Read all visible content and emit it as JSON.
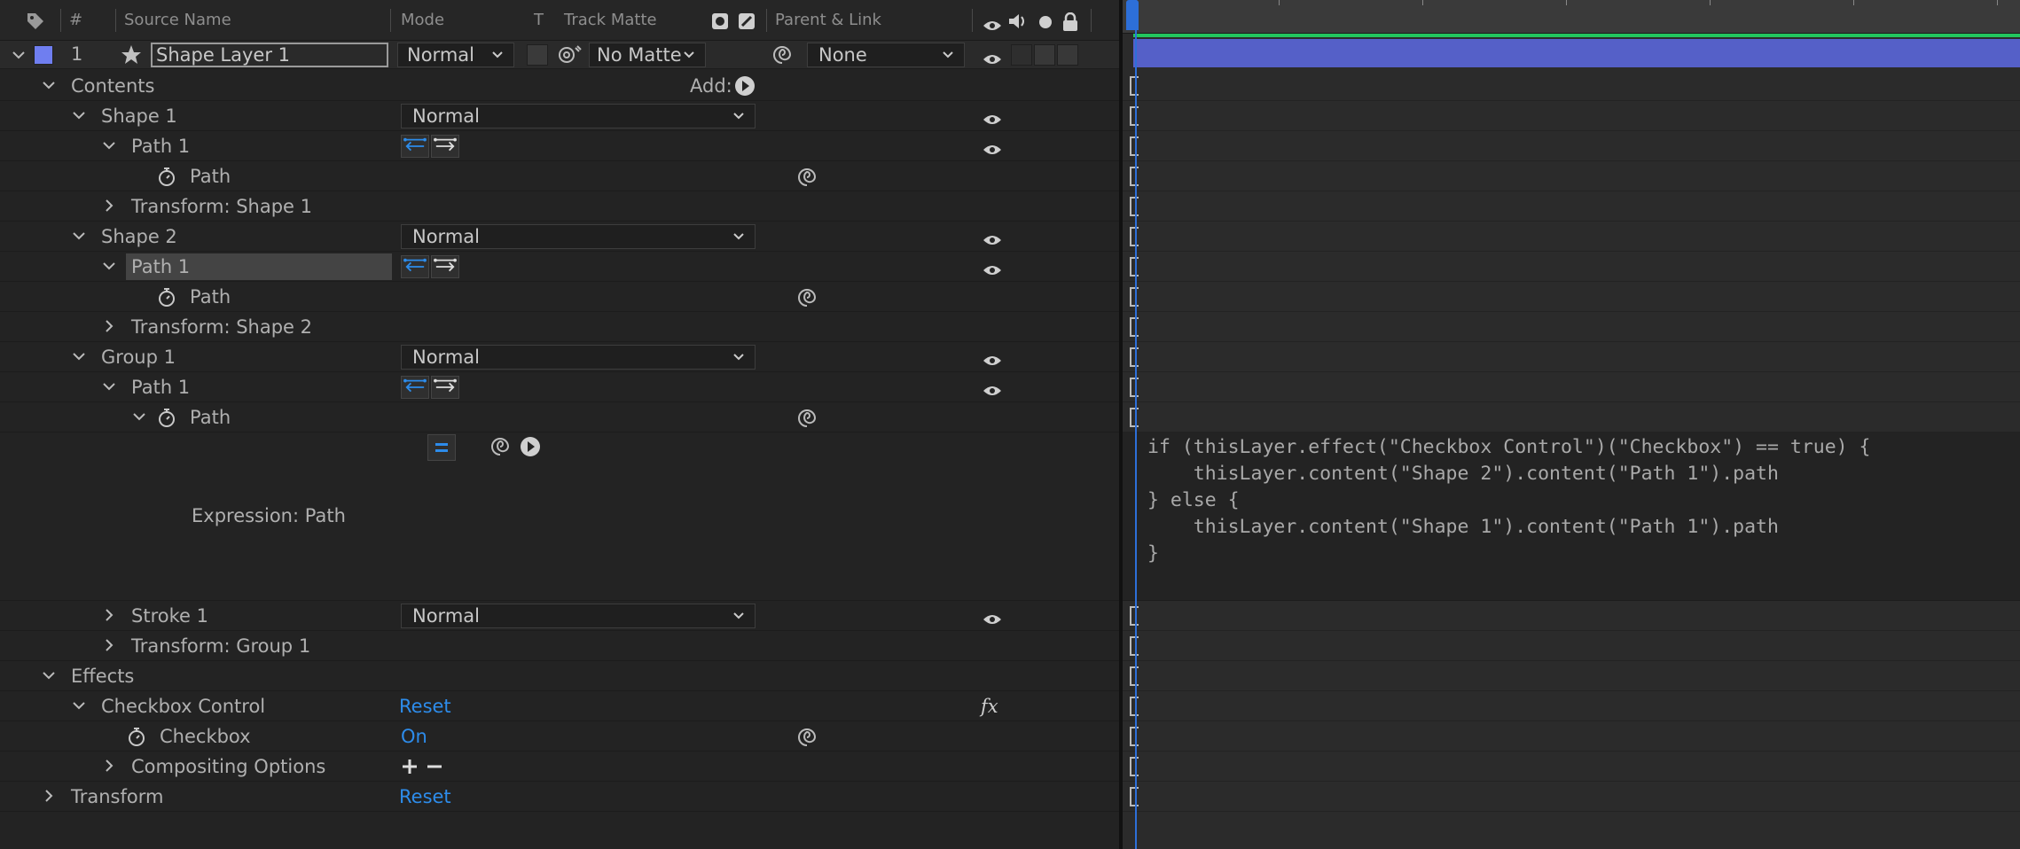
{
  "header": {
    "num": "#",
    "source_name": "Source Name",
    "mode": "Mode",
    "t": "T",
    "track_matte": "Track Matte",
    "parent_link": "Parent & Link"
  },
  "layer": {
    "number": "1",
    "name": "Shape Layer 1",
    "mode": "Normal",
    "track_matte": "No Matte",
    "parent": "None",
    "label_color": "#6f7ef0"
  },
  "rows": {
    "contents": "Contents",
    "add": "Add:",
    "shape1": "Shape 1",
    "shape1_mode": "Normal",
    "path1_a": "Path 1",
    "path_a": "Path",
    "transform_shape1": "Transform: Shape 1",
    "shape2": "Shape 2",
    "shape2_mode": "Normal",
    "path1_b": "Path 1",
    "path_b": "Path",
    "transform_shape2": "Transform: Shape 2",
    "group1": "Group 1",
    "group1_mode": "Normal",
    "path1_c": "Path 1",
    "path_c": "Path",
    "expression_label": "Expression: Path",
    "stroke1": "Stroke 1",
    "stroke1_mode": "Normal",
    "transform_group1": "Transform: Group 1",
    "effects": "Effects",
    "checkbox_control": "Checkbox Control",
    "reset1": "Reset",
    "fx": "fx",
    "checkbox": "Checkbox",
    "checkbox_value": "On",
    "compositing_options": "Compositing Options",
    "transform": "Transform",
    "reset2": "Reset"
  },
  "expression": {
    "line1": "if (thisLayer.effect(\"Checkbox Control\")(\"Checkbox\") == true) {",
    "line2": "    thisLayer.content(\"Shape 2\").content(\"Path 1\").path",
    "line3": "} else {",
    "line4": "    thisLayer.content(\"Shape 1\").content(\"Path 1\").path",
    "line5": "}"
  },
  "colors": {
    "accent_blue": "#2d8ceb",
    "layer_bar": "#5560c8",
    "work_area": "#22c55e"
  }
}
